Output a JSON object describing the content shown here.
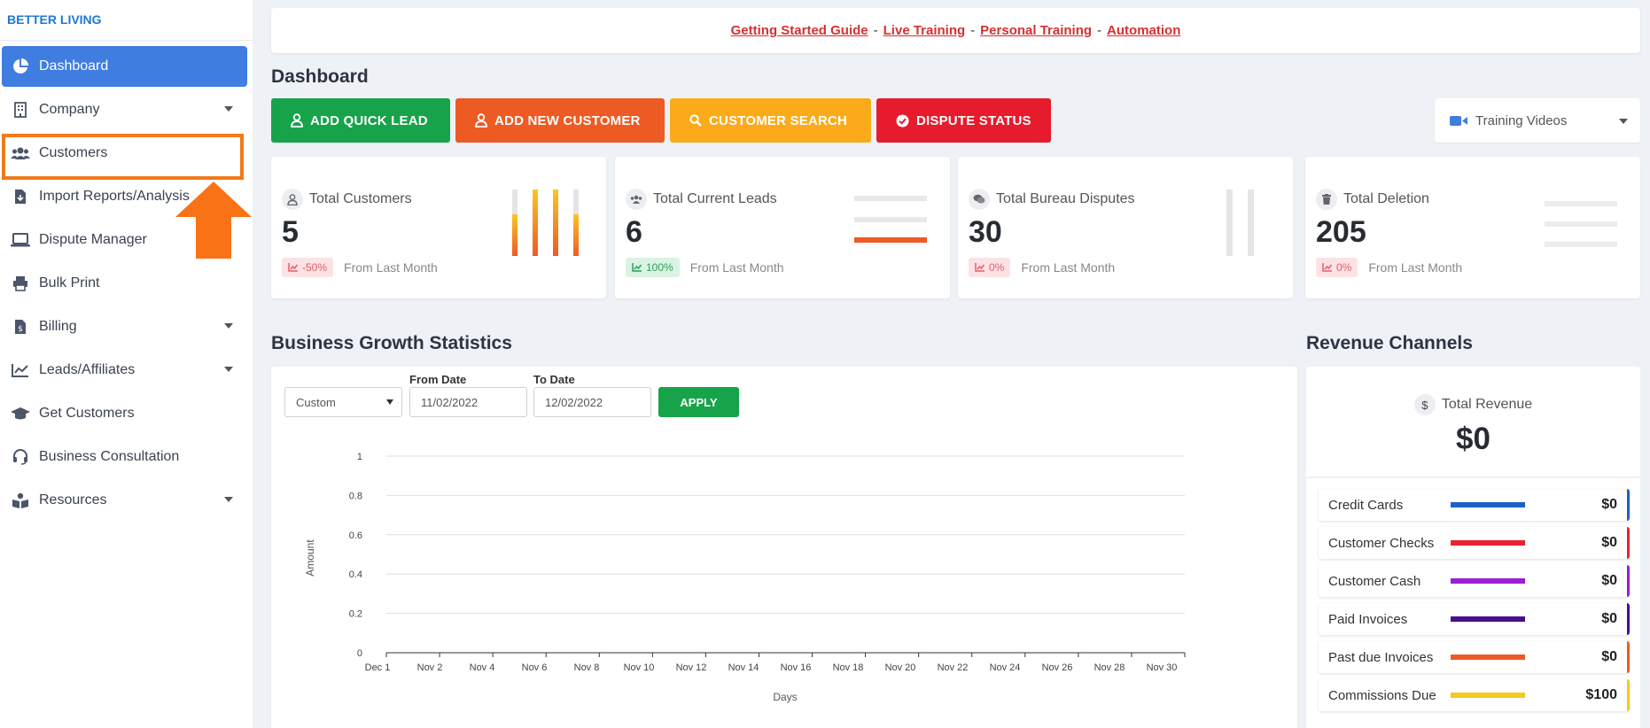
{
  "brand": "BETTER LIVING",
  "sidebar": {
    "items": [
      {
        "label": "Dashboard",
        "icon": "pie-chart-icon",
        "active": true
      },
      {
        "label": "Company",
        "icon": "building-icon",
        "caret": true
      },
      {
        "label": "Customers",
        "icon": "users-icon"
      },
      {
        "label": "Import Reports/Analysis",
        "icon": "file-import-icon"
      },
      {
        "label": "Dispute Manager",
        "icon": "laptop-icon"
      },
      {
        "label": "Bulk Print",
        "icon": "printer-icon"
      },
      {
        "label": "Billing",
        "icon": "invoice-icon",
        "caret": true
      },
      {
        "label": "Leads/Affiliates",
        "icon": "chart-line-icon",
        "caret": true
      },
      {
        "label": "Get Customers",
        "icon": "graduation-cap-icon"
      },
      {
        "label": "Business Consultation",
        "icon": "headset-icon"
      },
      {
        "label": "Resources",
        "icon": "book-reader-icon",
        "caret": true
      }
    ]
  },
  "banner": {
    "links": [
      "Getting Started Guide",
      "Live Training",
      "Personal Training",
      "Automation"
    ],
    "separator": "-"
  },
  "page_title": "Dashboard",
  "actions": {
    "add_quick_lead": "ADD QUICK LEAD",
    "add_new_customer": "ADD NEW CUSTOMER",
    "customer_search": "CUSTOMER SEARCH",
    "dispute_status": "DISPUTE STATUS"
  },
  "training_select": {
    "value": "Training Videos",
    "icon": "video-camera-icon"
  },
  "stats": [
    {
      "label": "Total Customers",
      "value": "5",
      "delta": "-50%",
      "delta_kind": "negative",
      "note": "From Last Month",
      "icon": "user-icon"
    },
    {
      "label": "Total Current Leads",
      "value": "6",
      "delta": "100%",
      "delta_kind": "positive",
      "note": "From Last Month",
      "icon": "users-icon"
    },
    {
      "label": "Total Bureau Disputes",
      "value": "30",
      "delta": "0%",
      "delta_kind": "negative",
      "note": "From Last Month",
      "icon": "comments-icon"
    },
    {
      "label": "Total Deletion",
      "value": "205",
      "delta": "0%",
      "delta_kind": "negative",
      "note": "From Last Month",
      "icon": "trash-icon"
    }
  ],
  "growth": {
    "title": "Business Growth Statistics",
    "range_select": "Custom",
    "from_label": "From Date",
    "from_value": "11/02/2022",
    "to_label": "To Date",
    "to_value": "12/02/2022",
    "apply_label": "APPLY"
  },
  "chart_data": {
    "type": "line",
    "title": "",
    "xlabel": "Days",
    "ylabel": "Amount",
    "x_ticks": [
      "Dec  1",
      "Nov  2",
      "Nov  4",
      "Nov  6",
      "Nov  8",
      "Nov 10",
      "Nov 12",
      "Nov 14",
      "Nov 16",
      "Nov 18",
      "Nov 20",
      "Nov 22",
      "Nov 24",
      "Nov 26",
      "Nov 28",
      "Nov 30"
    ],
    "y_ticks": [
      "0",
      "0.2",
      "0.4",
      "0.6",
      "0.8",
      "1"
    ],
    "ylim": [
      0,
      1
    ],
    "grid": true,
    "series": []
  },
  "revenue": {
    "title": "Revenue Channels",
    "total_label": "Total Revenue",
    "total_value": "$0",
    "total_icon": "dollar-icon",
    "channels": [
      {
        "label": "Credit Cards",
        "amount": "$0",
        "color": "#1e5fc8"
      },
      {
        "label": "Customer Checks",
        "amount": "$0",
        "color": "#e8222f"
      },
      {
        "label": "Customer Cash",
        "amount": "$0",
        "color": "#9b1ed1"
      },
      {
        "label": "Paid Invoices",
        "amount": "$0",
        "color": "#4b0f8c"
      },
      {
        "label": "Past due Invoices",
        "amount": "$0",
        "color": "#ee5a24"
      },
      {
        "label": "Commissions Due",
        "amount": "$100",
        "color": "#f4cb1a"
      }
    ]
  }
}
